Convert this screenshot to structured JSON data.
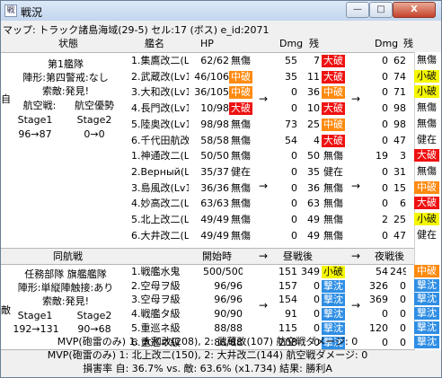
{
  "window": {
    "title": "戦況",
    "min": "—",
    "max": "□",
    "close": "X"
  },
  "map": "マップ: トラック諸島海域(29-5) セル:17 (ボス) e_id:2071",
  "headers": {
    "state": "状態",
    "name": "艦名",
    "hp": "HP",
    "dmg1": "Dmg",
    "ship1": "残",
    "dmg2": "Dmg",
    "ship2": "残"
  },
  "side_top": "自",
  "side_bottom": "敵",
  "friendly": {
    "fleet": "第1艦隊",
    "formation": "陣形:第四警戒:なし",
    "search": "索敵:発見!",
    "air": "航空戦:",
    "air_result": "航空優勢",
    "s1": "Stage1",
    "s2": "Stage2",
    "v1": "96→87",
    "v2": "0→0"
  },
  "friendly_ships": [
    {
      "name": "1.集鷹改二(Lv",
      "hp": "62/62",
      "st1": "無傷",
      "c1": "",
      "d1": "55",
      "r1": "7",
      "t1": "大破",
      "tc1": "red",
      "d2": "0",
      "r2": "62",
      "t2": "無傷",
      "tc2": ""
    },
    {
      "name": "2.武蔵改(Lv1",
      "hp": "46/106",
      "st1": "中破",
      "c1": "orange",
      "d1": "35",
      "r1": "11",
      "t1": "大破",
      "tc1": "red",
      "d2": "0",
      "r2": "74",
      "t2": "小破",
      "tc2": "yellow"
    },
    {
      "name": "3.大和改(Lv1",
      "hp": "36/105",
      "st1": "中破",
      "c1": "orange",
      "d1": "0",
      "r1": "36",
      "t1": "中破",
      "tc1": "orange",
      "d2": "0",
      "r2": "71",
      "t2": "小破",
      "tc2": "yellow"
    },
    {
      "name": "4.長門改(Lv1",
      "hp": "10/98",
      "st1": "大破",
      "c1": "red",
      "d1": "0",
      "r1": "10",
      "t1": "大破",
      "tc1": "red",
      "d2": "0",
      "r2": "98",
      "t2": "無傷",
      "tc2": ""
    },
    {
      "name": "5.陸奥改(Lv1",
      "hp": "98/98",
      "st1": "無傷",
      "c1": "",
      "d1": "73",
      "r1": "25",
      "t1": "中破",
      "tc1": "orange",
      "d2": "0",
      "r2": "98",
      "t2": "無傷",
      "tc2": ""
    },
    {
      "name": "6.千代田航改",
      "hp": "58/58",
      "st1": "無傷",
      "c1": "",
      "d1": "54",
      "r1": "4",
      "t1": "大破",
      "tc1": "red",
      "d2": "0",
      "r2": "47",
      "t2": "健在",
      "tc2": ""
    },
    {
      "name": "1.神通改二(Lv",
      "hp": "50/50",
      "st1": "無傷",
      "c1": "",
      "d1": "0",
      "r1": "50",
      "t1": "無傷",
      "tc1": "",
      "d2": "19",
      "r2": "3",
      "t2": "大破",
      "tc2": "red"
    },
    {
      "name": "2.Верный(Lv1",
      "hp": "35/37",
      "st1": "健在",
      "c1": "",
      "d1": "0",
      "r1": "35",
      "t1": "健在",
      "tc1": "",
      "d2": "0",
      "r2": "31",
      "t2": "無傷",
      "tc2": ""
    },
    {
      "name": "3.島風改(Lv1",
      "hp": "36/36",
      "st1": "無傷",
      "c1": "",
      "d1": "0",
      "r1": "36",
      "t1": "無傷",
      "tc1": "",
      "d2": "0",
      "r2": "15",
      "t2": "中破",
      "tc2": "orange"
    },
    {
      "name": "4.妙高改二(Lv",
      "hp": "63/63",
      "st1": "無傷",
      "c1": "",
      "d1": "0",
      "r1": "63",
      "t1": "無傷",
      "tc1": "",
      "d2": "0",
      "r2": "6",
      "t2": "大破",
      "tc2": "red"
    },
    {
      "name": "5.北上改二(Lv",
      "hp": "49/49",
      "st1": "無傷",
      "c1": "",
      "d1": "0",
      "r1": "49",
      "t1": "無傷",
      "tc1": "",
      "d2": "2",
      "r2": "25",
      "t2": "小破",
      "tc2": "yellow"
    },
    {
      "name": "6.大井改二(Lv",
      "hp": "49/49",
      "st1": "無傷",
      "c1": "",
      "d1": "0",
      "r1": "49",
      "t1": "無傷",
      "tc1": "",
      "d2": "0",
      "r2": "47",
      "t2": "健在",
      "tc2": ""
    }
  ],
  "enemy_headers": {
    "left": "同航戦",
    "start": "開始時",
    "day": "昼戦後",
    "night": "夜戦後"
  },
  "enemy": {
    "fleet": "任務部隊 旗艦艦隊",
    "formation": "陣形:単縦陣触接:あり",
    "search": "索敵:発見!",
    "s1": "Stage1",
    "s2": "Stage2",
    "v1": "192→131",
    "v2": "90→68"
  },
  "enemy_ships": [
    {
      "name": "1.戦艦水鬼",
      "hp": "500/500",
      "d1": "151",
      "r1": "349",
      "t1": "小破",
      "tc1": "yellow",
      "d2": "54",
      "r2": "249",
      "t2": "中破",
      "tc2": "orange"
    },
    {
      "name": "2.空母ヲ級",
      "hp": "96/96",
      "d1": "157",
      "r1": "0",
      "t1": "撃沈",
      "tc1": "blue",
      "d2": "326",
      "r2": "0",
      "t2": "撃沈",
      "tc2": "blue"
    },
    {
      "name": "3.空母ヲ級",
      "hp": "96/96",
      "d1": "154",
      "r1": "0",
      "t1": "撃沈",
      "tc1": "blue",
      "d2": "369",
      "r2": "0",
      "t2": "撃沈",
      "tc2": "blue"
    },
    {
      "name": "4.戦艦タ級",
      "hp": "90/90",
      "d1": "91",
      "r1": "0",
      "t1": "撃沈",
      "tc1": "blue",
      "d2": "0",
      "r2": "0",
      "t2": "撃沈",
      "tc2": "blue"
    },
    {
      "name": "5.重巡ネ級",
      "hp": "88/88",
      "d1": "115",
      "r1": "0",
      "t1": "撃沈",
      "tc1": "blue",
      "d2": "120",
      "r2": "0",
      "t2": "撃沈",
      "tc2": "blue"
    },
    {
      "name": "6.重巡ネ級",
      "hp": "88/88",
      "d1": "208",
      "r1": "0",
      "t1": "撃沈",
      "tc1": "blue",
      "d2": "0",
      "r2": "0",
      "t2": "撃沈",
      "tc2": "blue"
    }
  ],
  "footer": {
    "mvp1": "MVP(砲雷のみ) 1: 大和改(208), 2: 武蔵改(107) 航空戦ダメージ: 0",
    "mvp2": "MVP(砲雷のみ) 1: 北上改二(150), 2: 大井改二(144) 航空戦ダメージ: 0",
    "result": "損害率 自: 36.7% vs. 敵: 63.6% (x1.734) 結果: 勝利A"
  },
  "arrow": "→"
}
